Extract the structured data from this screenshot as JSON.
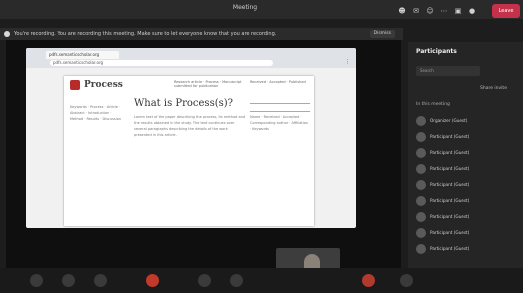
{
  "window": {
    "title": "Meeting"
  },
  "recording_banner": {
    "text": "You're recording. You are recording this meeting. Make sure to let everyone know that you are recording.",
    "dismiss_label": "Dismiss"
  },
  "controls": {
    "leave_label": "Leave"
  },
  "browser": {
    "tab_title": "pdfs.semanticscholar.org",
    "url": "pdfs.semanticscholar.org"
  },
  "document": {
    "brand": "Process",
    "header_left": "Research article · Process · Manuscript submitted for publication",
    "header_right": "Received · Accepted · Published",
    "heading": "What is Process(s)?",
    "sidebar_text": "Keywords · Process · Article · Abstract · Introduction · Method · Results · Discussion",
    "body_text": "Lorem text of the paper describing the process, its method and the results obtained in the study. The text continues over several paragraphs describing the details of the work presented in this article.",
    "right_col": "Name · Received · Accepted · Corresponding author · Affiliation · Keywords"
  },
  "panel": {
    "title": "Participants",
    "search_placeholder": "Search",
    "share_invite": "Share invite",
    "section_label": "In this meeting",
    "participants": [
      "Organizer (Guest)",
      "Participant (Guest)",
      "Participant (Guest)",
      "Participant (Guest)",
      "Participant (Guest)",
      "Participant (Guest)",
      "Participant (Guest)",
      "Participant (Guest)",
      "Participant (Guest)"
    ]
  }
}
